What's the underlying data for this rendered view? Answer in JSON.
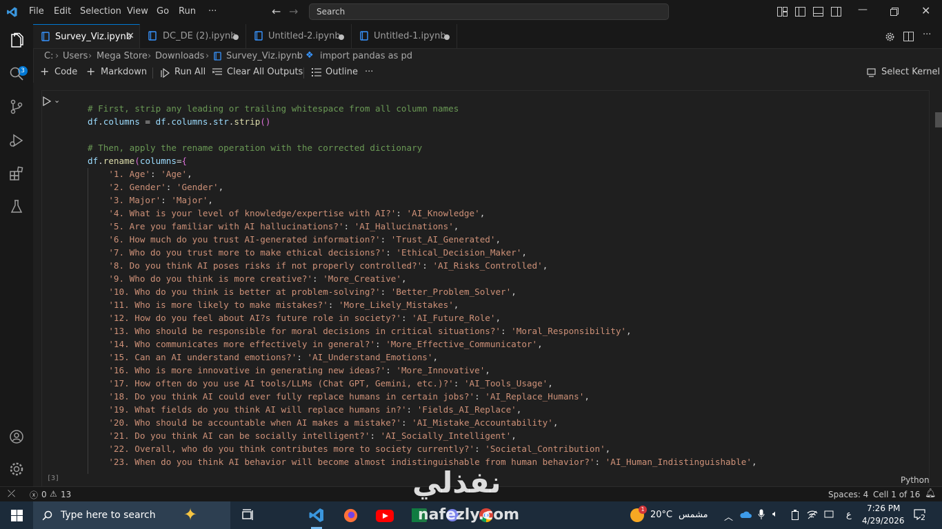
{
  "menu": [
    "File",
    "Edit",
    "Selection",
    "View",
    "Go",
    "Run",
    "···"
  ],
  "search": {
    "placeholder": "Search"
  },
  "activity": {
    "explorer_badge": "3"
  },
  "tabs": [
    {
      "label": "Survey_Viz.ipynb",
      "active": true
    },
    {
      "label": "DC_DE (2).ipynb",
      "active": false
    },
    {
      "label": "Untitled-2.ipynb",
      "active": false
    },
    {
      "label": "Untitled-1.ipynb",
      "active": false
    }
  ],
  "breadcrumb": [
    "C:",
    "Users",
    "Mega Store",
    "Downloads",
    "Survey_Viz.ipynb",
    "import pandas as pd"
  ],
  "toolbar": {
    "code": "Code",
    "markdown": "Markdown",
    "run_all": "Run All",
    "clear_outputs": "Clear All Outputs",
    "outline": "Outline",
    "more": "···",
    "select_kernel": "Select Kernel"
  },
  "cell": {
    "exec_count": "[3]",
    "language": "Python",
    "code": [
      {
        "t": "comment",
        "s": "# First, strip any leading or trailing whitespace from all column names"
      },
      {
        "t": "assign",
        "s": "df.columns = df.columns.str.strip()"
      },
      {
        "t": "blank",
        "s": ""
      },
      {
        "t": "comment",
        "s": "# Then, apply the rename operation with the corrected dictionary"
      },
      {
        "t": "call",
        "s": "df.rename(columns={"
      },
      {
        "t": "pair",
        "k": "'1. Age'",
        "v": "'Age'"
      },
      {
        "t": "pair",
        "k": "'2. Gender'",
        "v": "'Gender'"
      },
      {
        "t": "pair",
        "k": "'3. Major'",
        "v": "'Major'"
      },
      {
        "t": "pair",
        "k": "'4. What is your level of knowledge/expertise with AI?'",
        "v": "'AI_Knowledge'"
      },
      {
        "t": "pair",
        "k": "'5. Are you familiar with AI hallucinations?'",
        "v": "'AI_Hallucinations'"
      },
      {
        "t": "pair",
        "k": "'6. How much do you trust AI-generated information?'",
        "v": "'Trust_AI_Generated'"
      },
      {
        "t": "pair",
        "k": "'7. Who do you trust more to make ethical decisions?'",
        "v": "'Ethical_Decision_Maker'"
      },
      {
        "t": "pair",
        "k": "'8. Do you think AI poses risks if not properly controlled?'",
        "v": "'AI_Risks_Controlled'"
      },
      {
        "t": "pair",
        "k": "'9. Who do you think is more creative?'",
        "v": "'More_Creative'"
      },
      {
        "t": "pair",
        "k": "'10. Who do you think is better at problem-solving?'",
        "v": "'Better_Problem_Solver'"
      },
      {
        "t": "pair",
        "k": "'11. Who is more likely to make mistakes?'",
        "v": "'More_Likely_Mistakes'"
      },
      {
        "t": "pair",
        "k": "'12. How do you feel about AI?s future role in society?'",
        "v": "'AI_Future_Role'"
      },
      {
        "t": "pair",
        "k": "'13. Who should be responsible for moral decisions in critical situations?'",
        "v": "'Moral_Responsibility'"
      },
      {
        "t": "pair",
        "k": "'14. Who communicates more effectively in general?'",
        "v": "'More_Effective_Communicator'"
      },
      {
        "t": "pair",
        "k": "'15. Can an AI understand emotions?'",
        "v": "'AI_Understand_Emotions'"
      },
      {
        "t": "pair",
        "k": "'16. Who is more innovative in generating new ideas?'",
        "v": "'More_Innovative'"
      },
      {
        "t": "pair",
        "k": "'17. How often do you use AI tools/LLMs (Chat GPT, Gemini, etc.)?'",
        "v": "'AI_Tools_Usage'"
      },
      {
        "t": "pair",
        "k": "'18. Do you think AI could ever fully replace humans in certain jobs?'",
        "v": "'AI_Replace_Humans'"
      },
      {
        "t": "pair",
        "k": "'19. What fields do you think AI will replace humans in?'",
        "v": "'Fields_AI_Replace'"
      },
      {
        "t": "pair",
        "k": "'20. Who should be accountable when AI makes a mistake?'",
        "v": "'AI_Mistake_Accountability'"
      },
      {
        "t": "pair",
        "k": "'21. Do you think AI can be socially intelligent?'",
        "v": "'AI_Socially_Intelligent'"
      },
      {
        "t": "pair",
        "k": "'22. Overall, who do you think contributes more to society currently?'",
        "v": "'Societal_Contribution'"
      },
      {
        "t": "pair",
        "k": "'23. When do you think AI behavior will become almost indistinguishable from human behavior?'",
        "v": "'AI_Human_Indistinguishable'"
      }
    ]
  },
  "status": {
    "errors": "0",
    "warnings": "13",
    "spaces": "Spaces: 4",
    "cell_pos": "Cell 1 of 16"
  },
  "taskbar": {
    "search_placeholder": "Type here to search",
    "weather_temp": "20°C",
    "weather_text": "مشمس",
    "weather_badge": "1",
    "lang": "ع",
    "time": "7:26 PM",
    "date": "4/29/2026",
    "notif_count": "2"
  },
  "watermark": {
    "arabic": "نفذلي",
    "site": "nafezly.com"
  },
  "colors": {
    "accent": "#0078d4",
    "comment": "#6a9955",
    "string": "#ce9178",
    "variable": "#9cdcfe",
    "function": "#dcdcaa"
  }
}
